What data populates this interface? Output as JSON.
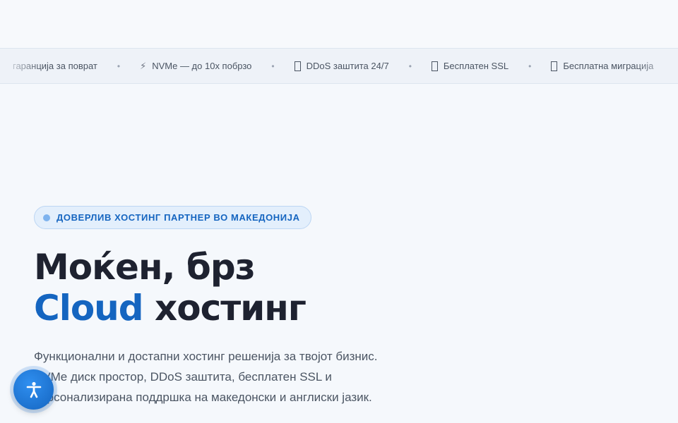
{
  "ticker": {
    "items": [
      {
        "icon": "none",
        "label": "гаранција за поврат"
      },
      {
        "icon": "bolt-icon",
        "glyph": "⚡",
        "label": "NVMe — до 10x побрзо"
      },
      {
        "icon": "shield-icon",
        "label": "DDoS заштита 24/7"
      },
      {
        "icon": "lock-icon",
        "label": "Бесплатен SSL"
      },
      {
        "icon": "migration-icon",
        "label": "Бесплатна миграција"
      }
    ],
    "separator": "•"
  },
  "hero": {
    "badge": "ДОВЕРЛИВ ХОСТИНГ ПАРТНЕР ВО МАКЕДОНИЈА",
    "title_line1": "Моќен, брз",
    "title_accent": "Cloud",
    "title_rest": " хостинг",
    "description": "Функционални и достапни хостинг решенија за твојот бизнис. NVMe диск простор, DDoS заштита, бесплатен SSL и персонализирана поддршка на македонски и англиски јазик."
  },
  "accessibility": {
    "icon": "accessibility-icon"
  },
  "colors": {
    "accent": "#1565c0",
    "title": "#1e2230",
    "background": "#f5f8fc"
  }
}
